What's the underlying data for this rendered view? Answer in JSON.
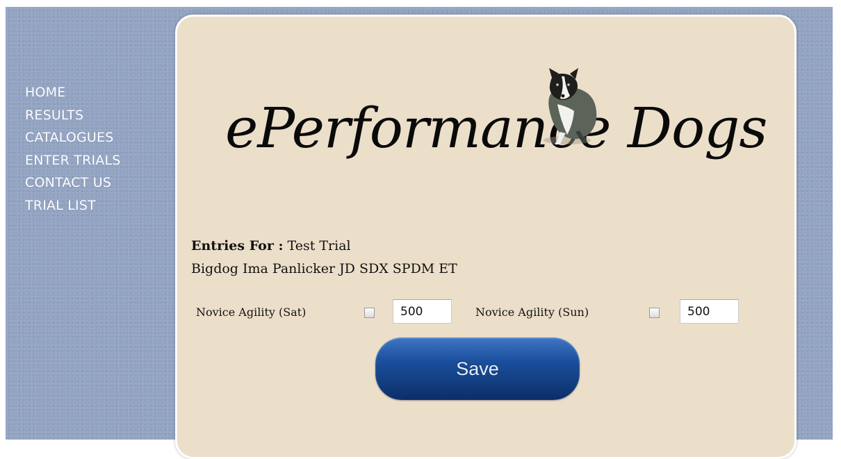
{
  "nav": {
    "items": [
      "HOME",
      "RESULTS",
      "CATALOGUES",
      "ENTER TRIALS",
      "CONTACT US",
      "TRIAL LIST"
    ]
  },
  "logo": {
    "text": "ePerformance Dogs",
    "image": "border-collie-photo"
  },
  "entries": {
    "label": "Entries For :",
    "trial_name": "Test Trial",
    "dog_name": "Bigdog Ima Panlicker JD SDX SPDM ET"
  },
  "classes": [
    {
      "label": "Novice Agility (Sat)",
      "checked": false,
      "fee": "500"
    },
    {
      "label": "Novice Agility (Sun)",
      "checked": false,
      "fee": "500"
    }
  ],
  "save_label": "Save",
  "colors": {
    "page_background": "#93a4c2",
    "panel_background": "#ecdfca",
    "nav_text": "#ffffff",
    "button_top": "#3f76c4",
    "button_bottom": "#0c2e68"
  }
}
